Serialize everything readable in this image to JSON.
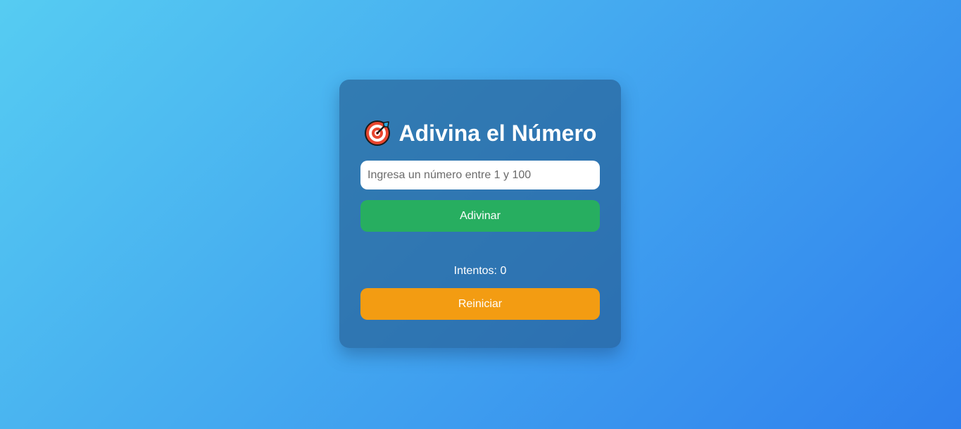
{
  "game": {
    "title": "Adivina el Número",
    "title_icon": "target-icon",
    "input_placeholder": "Ingresa un número entre 1 y 100",
    "input_value": "",
    "guess_button_label": "Adivinar",
    "message": "",
    "attempts_label": "Intentos:",
    "attempts_count": "0",
    "reset_button_label": "Reiniciar"
  },
  "colors": {
    "background_start": "#56ccf2",
    "background_end": "#2f80ed",
    "card": "#2f6fa3",
    "guess_button": "#27ae60",
    "reset_button": "#f39c12",
    "text": "#ffffff"
  }
}
